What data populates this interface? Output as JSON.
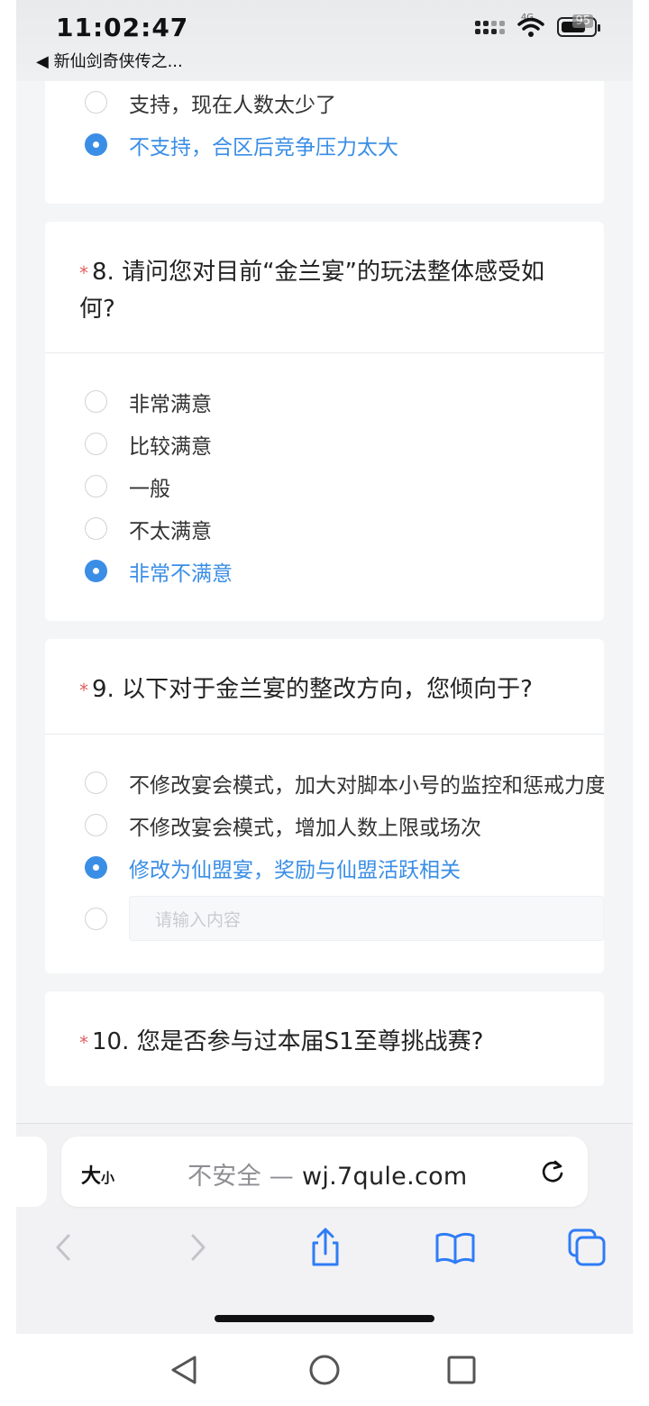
{
  "status": {
    "time": "11:02:47",
    "back_app": "◀ 新仙剑奇侠传之...",
    "battery": "95",
    "network": "4G"
  },
  "questions": [
    {
      "id": "q7",
      "options": [
        {
          "label": "支持，现在人数太少了",
          "selected": false
        },
        {
          "label": "不支持，合区后竞争压力太大",
          "selected": true
        }
      ]
    },
    {
      "id": "q8",
      "star": "*",
      "title": "8. 请问您对目前“金兰宴”的玩法整体感受如何?",
      "options": [
        {
          "label": "非常满意",
          "selected": false
        },
        {
          "label": "比较满意",
          "selected": false
        },
        {
          "label": "一般",
          "selected": false
        },
        {
          "label": "不太满意",
          "selected": false
        },
        {
          "label": "非常不满意",
          "selected": true
        }
      ]
    },
    {
      "id": "q9",
      "star": "*",
      "title": "9. 以下对于金兰宴的整改方向，您倾向于?",
      "options": [
        {
          "label": "不修改宴会模式，加大对脚本小号的监控和惩戒力度",
          "selected": false
        },
        {
          "label": "不修改宴会模式，增加人数上限或场次",
          "selected": false
        },
        {
          "label": "修改为仙盟宴，奖励与仙盟活跃相关",
          "selected": true
        }
      ],
      "other_placeholder": "请输入内容"
    },
    {
      "id": "q10",
      "star": "*",
      "title": "10. 您是否参与过本届S1至尊挑战赛?"
    }
  ],
  "browser": {
    "text_size_label_big": "大",
    "text_size_label_small": "小",
    "insecure_label": "不安全 — ",
    "domain": "wj.7qule.com"
  },
  "colors": {
    "accent": "#3a8ee6",
    "required_star": "#e06060",
    "page_bg": "#f4f5f7"
  }
}
